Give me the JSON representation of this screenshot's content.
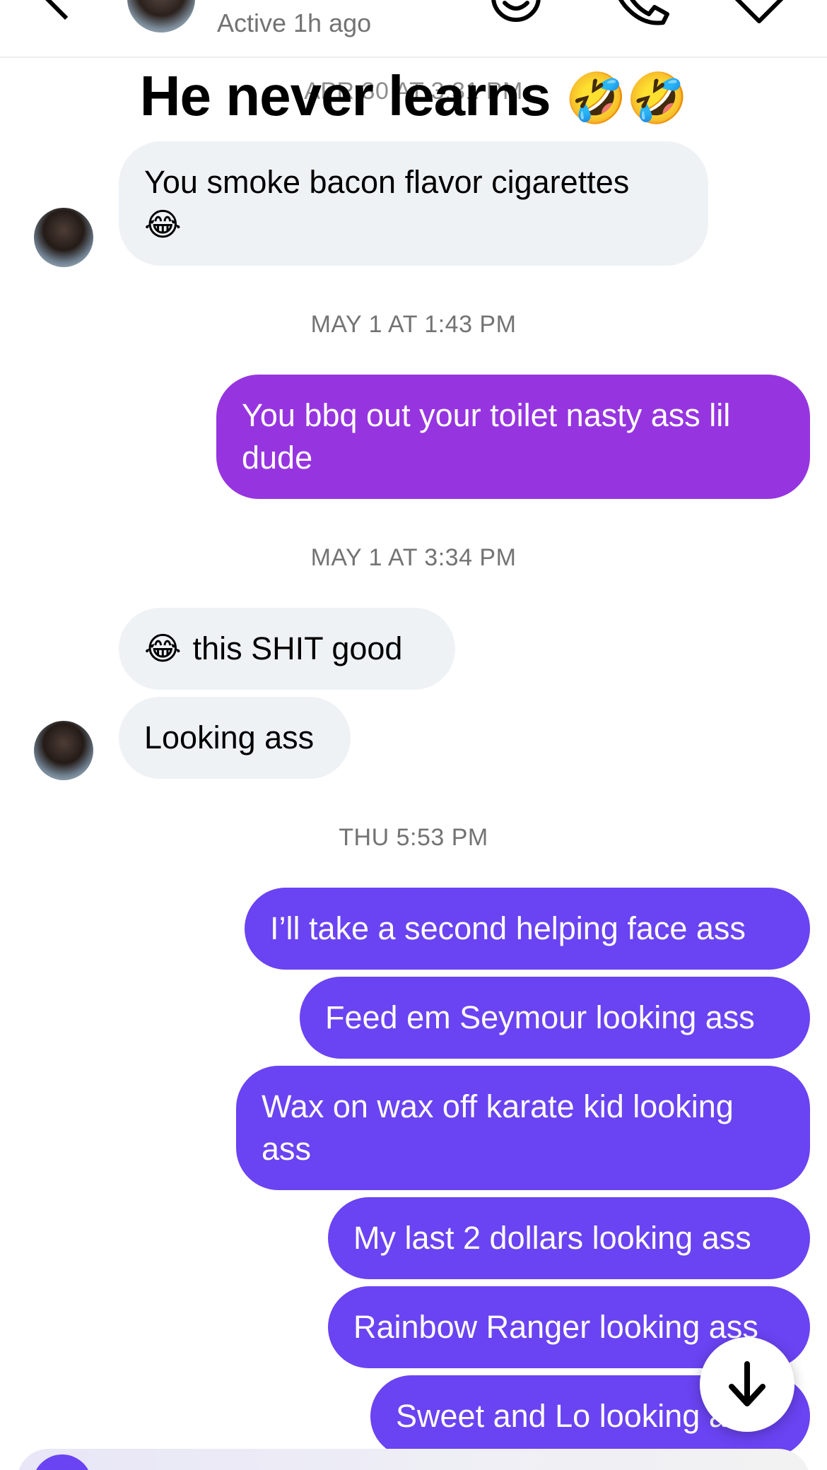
{
  "header": {
    "active_status": "Active 1h ago",
    "icons": [
      "back-chevron-icon",
      "profile-avatar",
      "sticker-icon",
      "phone-icon",
      "video-icon"
    ]
  },
  "caption": {
    "text": "He never learns",
    "emoji": "🤣🤣"
  },
  "thread": {
    "ts_top": "APR 30 AT 3:31 PM",
    "ts_may1_a": "MAY 1 AT 1:43 PM",
    "ts_may1_b": "MAY 1 AT 3:34 PM",
    "ts_thu": "THU 5:53 PM",
    "messages": [
      {
        "from": "them",
        "line1": "You smoke bacon flavor cigarettes",
        "emoji": "😂"
      },
      {
        "from": "me",
        "line1": "You bbq out your toilet nasty ass lil",
        "line2": "dude"
      },
      {
        "from": "them",
        "emoji": "😂",
        "text": "this SHIT good"
      },
      {
        "from": "them",
        "text": "Looking ass"
      },
      {
        "from": "me",
        "text": "I’ll take a second helping face ass"
      },
      {
        "from": "me",
        "text": "Feed em Seymour looking ass"
      },
      {
        "from": "me",
        "line1": "Wax on wax off karate kid looking",
        "line2": "ass"
      },
      {
        "from": "me",
        "text": "My last 2 dollars looking ass"
      },
      {
        "from": "me",
        "text": "Rainbow Ranger looking ass"
      },
      {
        "from": "me",
        "text": "Sweet and Lo looking ass"
      }
    ]
  },
  "colors": {
    "incoming_bubble": "#eff2f5",
    "outgoing_purple": "#9635e0",
    "outgoing_violet": "#6a43f2",
    "timestamp": "#737373"
  },
  "scroll_button_icon": "arrow-down-icon"
}
